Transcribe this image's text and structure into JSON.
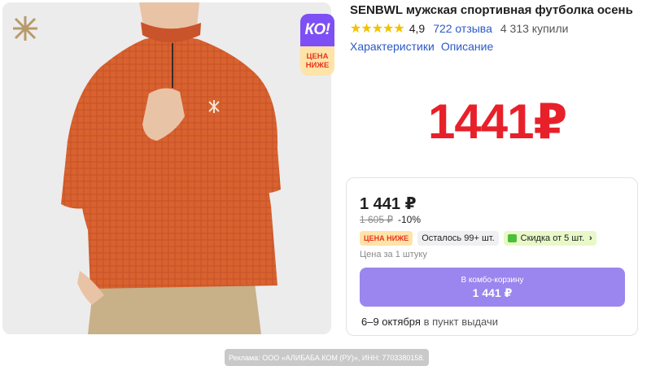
{
  "product": {
    "title": "SENBWL мужская спортивная футболка осень",
    "rating": "4,9",
    "reviews": "722 отзыва",
    "purchases": "4 313 купили",
    "stars_icon": "star-icon",
    "stars_count": 5
  },
  "nav": {
    "characteristics": "Характеристики",
    "description": "Описание"
  },
  "promo_badge": {
    "ko": "КО!",
    "line1": "ЦЕНА",
    "line2": "НИЖЕ",
    "colors": {
      "top": "#7e4ff5",
      "bottom": "#ffe3a8",
      "text": "#e5361f"
    }
  },
  "big_price": "1441₽",
  "card": {
    "price": "1 441 ₽",
    "old_price": "1 605 ₽",
    "discount": "-10%",
    "badge_low_price": "ЦЕНА НИЖЕ",
    "badge_stock": "Осталось 99+ шт.",
    "badge_bulk": "Скидка от 5 шт.",
    "per_unit": "Цена за 1 штуку",
    "combo_label": "В комбо-корзину",
    "combo_price": "1 441 ₽",
    "delivery_dates": "6–9 октября",
    "delivery_text": "в пункт выдачи"
  },
  "ad_notice": "Реклама: ООО «АЛИБАБА.КОМ (РУ)», ИНН: 7703380158.",
  "colors": {
    "accent_red": "#e8202a",
    "link_blue": "#2c59c8",
    "button_purple": "#9a86ee",
    "shirt_orange": "#d9622f"
  }
}
